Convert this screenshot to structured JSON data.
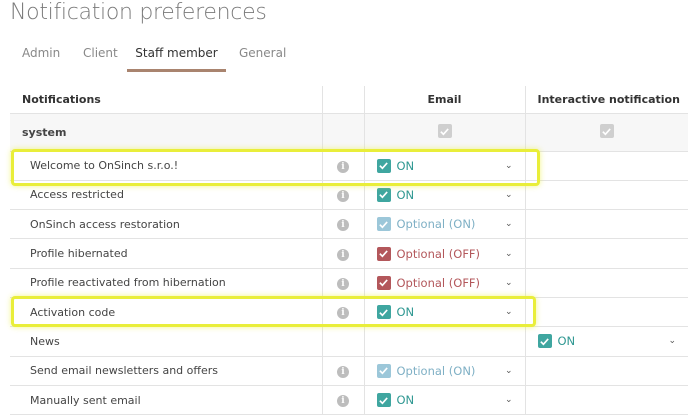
{
  "page": {
    "title": "Notification preferences"
  },
  "tabs": [
    {
      "label": "Admin",
      "active": false
    },
    {
      "label": "Client",
      "active": false
    },
    {
      "label": "Staff member",
      "active": true
    },
    {
      "label": "General",
      "active": false
    }
  ],
  "table": {
    "headers": {
      "notifications": "Notifications",
      "info": "",
      "email": "Email",
      "interactive": "Interactive notification"
    },
    "section": {
      "label": "system"
    },
    "rows": [
      {
        "label": "Welcome to OnSinch s.r.o.!",
        "email": "ON",
        "interactive": ""
      },
      {
        "label": "Access restricted",
        "email": "ON",
        "interactive": ""
      },
      {
        "label": "OnSinch access restoration",
        "email": "Optional (ON)",
        "interactive": ""
      },
      {
        "label": "Profile hibernated",
        "email": "Optional (OFF)",
        "interactive": ""
      },
      {
        "label": "Profile reactivated from hibernation",
        "email": "Optional (OFF)",
        "interactive": ""
      },
      {
        "label": "Activation code",
        "email": "ON",
        "interactive": ""
      },
      {
        "label": "News",
        "email": "",
        "interactive": "ON"
      },
      {
        "label": "Send email newsletters and offers",
        "email": "Optional (ON)",
        "interactive": ""
      },
      {
        "label": "Manually sent email",
        "email": "ON",
        "interactive": ""
      }
    ]
  },
  "icons": {
    "info": "info-icon",
    "check": "check-icon",
    "chevron": "chevron-down-icon"
  },
  "colors": {
    "teal": "#3fa6a0",
    "teal_light": "#9cc7d9",
    "red": "#b3575b",
    "highlight": "#e9ee3a",
    "tab_underline": "#a9846f"
  }
}
